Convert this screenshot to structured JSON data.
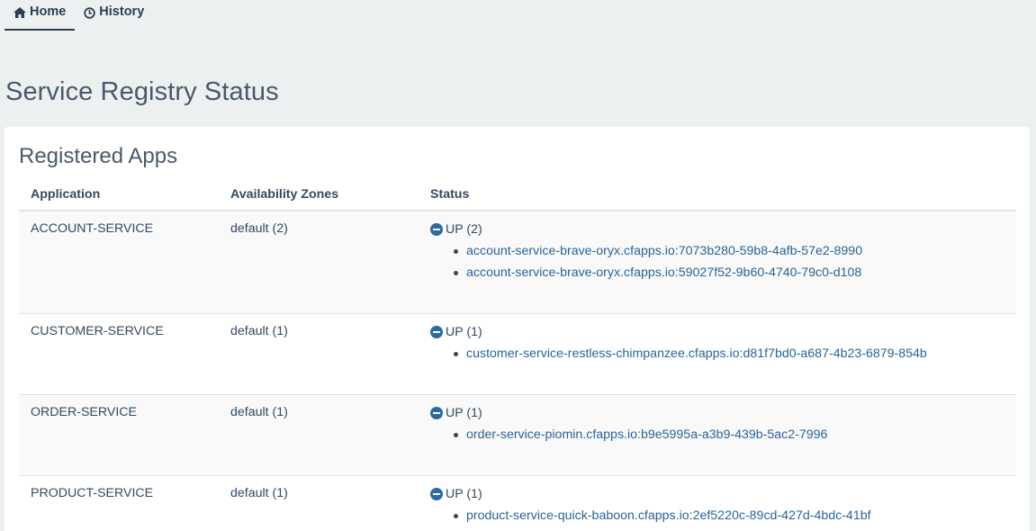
{
  "nav": {
    "home_label": "Home",
    "history_label": "History"
  },
  "page_title": "Service Registry Status",
  "registered_apps": {
    "title": "Registered Apps",
    "headers": [
      "Application",
      "Availability Zones",
      "Status"
    ],
    "rows": [
      {
        "application": "ACCOUNT-SERVICE",
        "zones": "default (2)",
        "status": "UP (2)",
        "instances": [
          "account-service-brave-oryx.cfapps.io:7073b280-59b8-4afb-57e2-8990",
          "account-service-brave-oryx.cfapps.io:59027f52-9b60-4740-79c0-d108"
        ]
      },
      {
        "application": "CUSTOMER-SERVICE",
        "zones": "default (1)",
        "status": "UP (1)",
        "instances": [
          "customer-service-restless-chimpanzee.cfapps.io:d81f7bd0-a687-4b23-6879-854b"
        ]
      },
      {
        "application": "ORDER-SERVICE",
        "zones": "default (1)",
        "status": "UP (1)",
        "instances": [
          "order-service-piomin.cfapps.io:b9e5995a-a3b9-439b-5ac2-7996"
        ]
      },
      {
        "application": "PRODUCT-SERVICE",
        "zones": "default (1)",
        "status": "UP (1)",
        "instances": [
          "product-service-quick-baboon.cfapps.io:2ef5220c-89cd-427d-4bdc-41bf"
        ]
      }
    ]
  },
  "colors": {
    "background": "#ecf0f1",
    "panel": "#ffffff",
    "text": "#34495e",
    "link": "#2a6496",
    "status_icon": "#2c6aa0"
  },
  "icons": {
    "home": "home-icon",
    "history": "clock-icon",
    "status": "minus-circle-icon"
  }
}
